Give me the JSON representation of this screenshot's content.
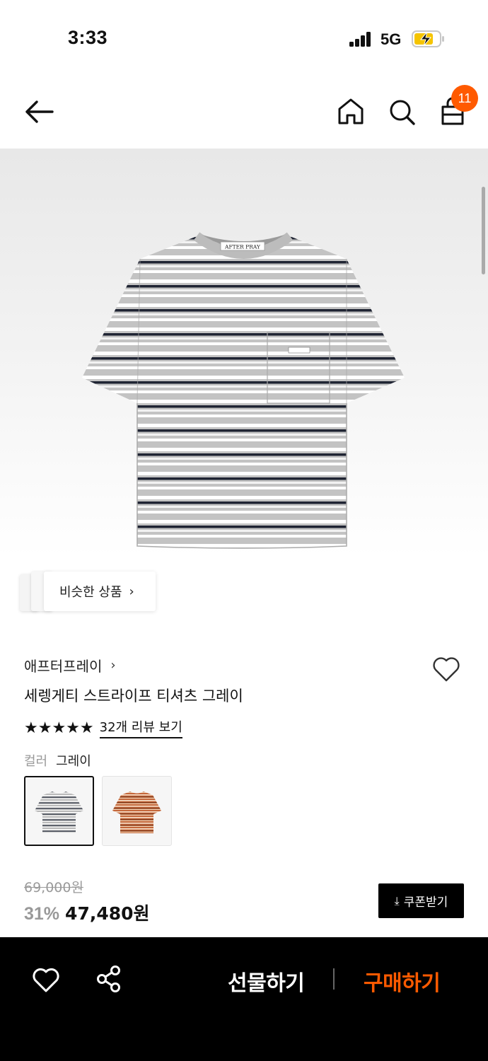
{
  "status_bar": {
    "time": "3:33",
    "network": "5G"
  },
  "header": {
    "cart_count": "11"
  },
  "similar": {
    "label": "비슷한 상품",
    "chevron": "›"
  },
  "product": {
    "brand": "애프터프레이",
    "brand_chevron": "›",
    "title": "세렝게티 스트라이프 티셔츠 그레이",
    "stars": "★★★★★",
    "rating": 5,
    "review_link": "32개 리뷰 보기",
    "color_label": "컬러",
    "color_value": "그레이",
    "swatches": [
      "gray",
      "orange"
    ]
  },
  "price": {
    "original": "69,000원",
    "discount": "31%",
    "sale": "47,480원",
    "coupon_label": "쿠폰받기",
    "coupon_icon": "⤓"
  },
  "actions": {
    "gift": "선물하기",
    "buy": "구매하기"
  },
  "colors": {
    "accent": "#ff5a00",
    "bar_bg": "#000000"
  },
  "icons": [
    "back-arrow-icon",
    "home-icon",
    "search-icon",
    "shopping-bag-icon",
    "heart-icon",
    "share-icon",
    "download-icon"
  ]
}
